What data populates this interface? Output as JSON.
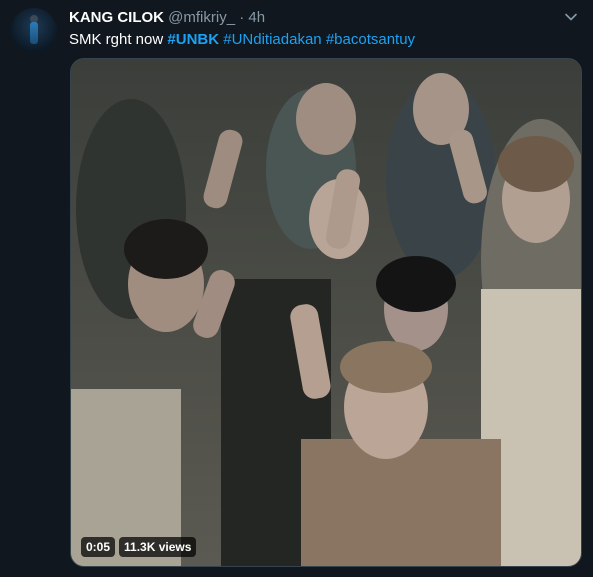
{
  "tweet": {
    "author_name": "KANG CILOK",
    "author_handle": "@mfikriy_",
    "separator": "·",
    "time_ago": "4h",
    "text_plain": "SMK rght now",
    "hashtags": [
      "#UNBK",
      "#UNditiadakan",
      "#bacotsantuy"
    ]
  },
  "video": {
    "elapsed": "0:05",
    "views": "11.3K views"
  },
  "icons": {
    "avatar": "user-avatar",
    "menu": "chevron-down-icon"
  },
  "colors": {
    "background": "#10171e",
    "link": "#1da1f2",
    "muted": "#8899a6"
  }
}
